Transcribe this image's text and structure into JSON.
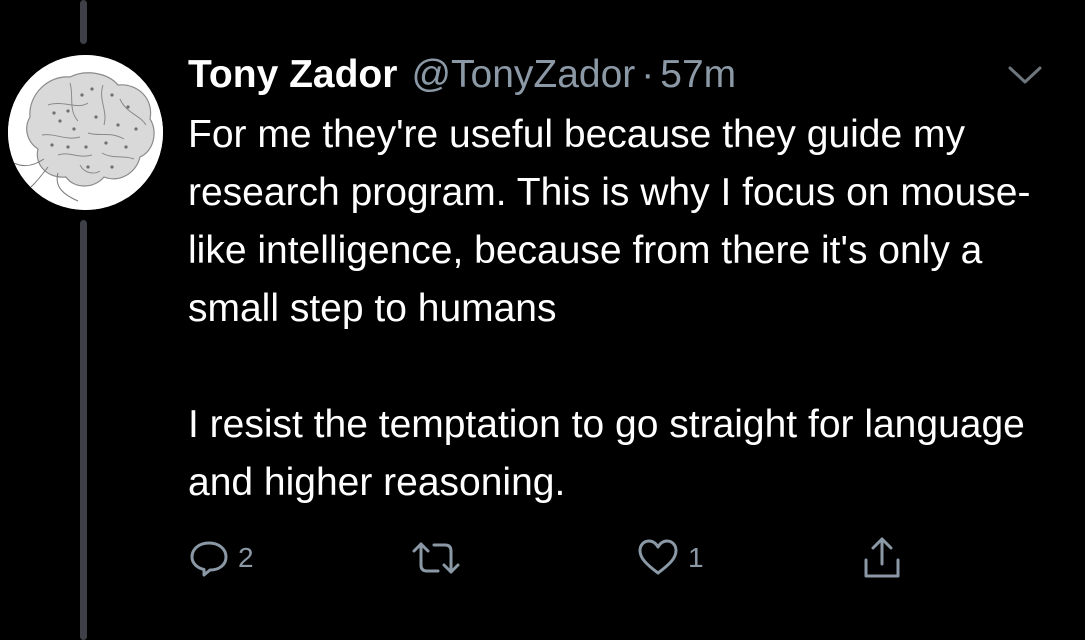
{
  "tweet": {
    "author_name": "Tony Zador",
    "author_handle": "@TonyZador",
    "separator": "·",
    "time": "57m",
    "paragraphs": [
      "For me they're useful because they guide my research program. This is why I focus on mouse-like intelligence, because from there it's only a small step to humans",
      "I resist the temptation to go straight for language and higher reasoning."
    ]
  },
  "actions": {
    "reply_count": "2",
    "retweet_count": "",
    "like_count": "1"
  },
  "icons": {
    "avatar": "brain-illustration",
    "caret": "chevron-down-icon",
    "reply": "reply-icon",
    "retweet": "retweet-icon",
    "like": "heart-icon",
    "share": "share-icon"
  },
  "colors": {
    "background": "#000000",
    "text": "#ffffff",
    "secondary": "#8b98a5",
    "thread_line": "#3d4147"
  }
}
